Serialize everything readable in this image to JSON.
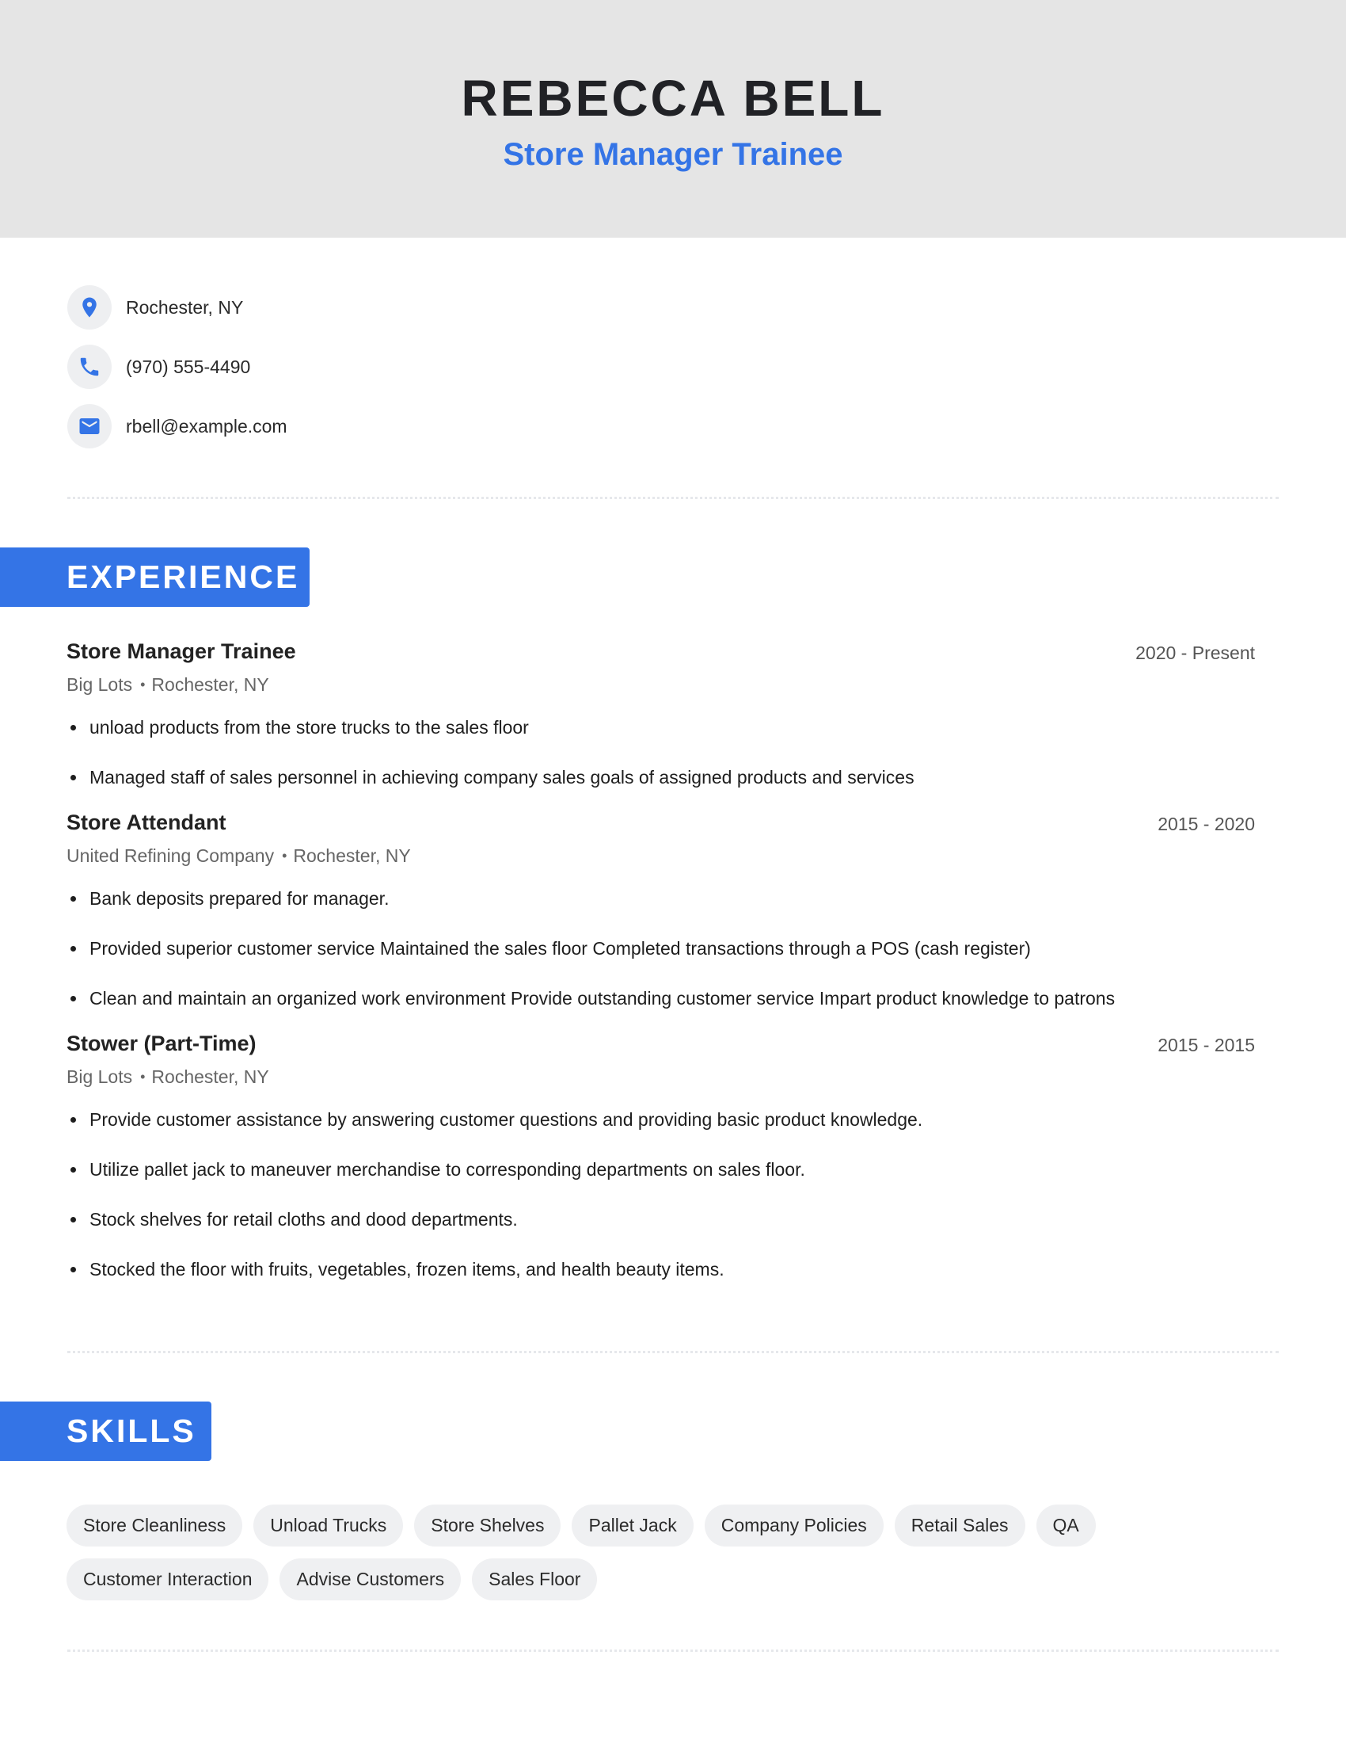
{
  "header": {
    "name": "REBECCA BELL",
    "title": "Store Manager Trainee"
  },
  "contact": {
    "items": [
      {
        "icon": "location-pin-icon",
        "text": "Rochester, NY"
      },
      {
        "icon": "phone-icon",
        "text": "(970) 555-4490"
      },
      {
        "icon": "email-icon",
        "text": "rbell@example.com"
      }
    ]
  },
  "colors": {
    "accent": "#3474e6",
    "header_bg": "#e5e5e5",
    "chip_bg": "#eff0f2",
    "icon_circle_bg": "#eeeff1"
  },
  "experience": {
    "heading": "EXPERIENCE",
    "jobs": [
      {
        "title": "Store Manager Trainee",
        "dates": "2020 - Present",
        "company": "Big Lots",
        "location": "Rochester, NY",
        "bullets": [
          "unload products from the store trucks to the sales floor",
          "Managed staff of sales personnel in achieving company sales goals of assigned products and services"
        ]
      },
      {
        "title": "Store Attendant",
        "dates": "2015 - 2020",
        "company": "United Refining Company",
        "location": "Rochester, NY",
        "bullets": [
          "Bank deposits prepared for manager.",
          "Provided superior customer service Maintained the sales floor Completed transactions through a POS (cash register)",
          "Clean and maintain an organized work environment Provide outstanding customer service Impart product knowledge to patrons"
        ]
      },
      {
        "title": "Stower (Part-Time)",
        "dates": "2015 - 2015",
        "company": "Big Lots",
        "location": "Rochester, NY",
        "bullets": [
          "Provide customer assistance by answering customer questions and providing basic product knowledge.",
          "Utilize pallet jack to maneuver merchandise to corresponding departments on sales floor.",
          "Stock shelves for retail cloths and dood departments.",
          "Stocked the floor with fruits, vegetables, frozen items, and health beauty items."
        ]
      }
    ]
  },
  "skills": {
    "heading": "SKILLS",
    "items": [
      "Store Cleanliness",
      "Unload Trucks",
      "Store Shelves",
      "Pallet Jack",
      "Company Policies",
      "Retail Sales",
      "QA",
      "Customer Interaction",
      "Advise Customers",
      "Sales Floor"
    ]
  }
}
